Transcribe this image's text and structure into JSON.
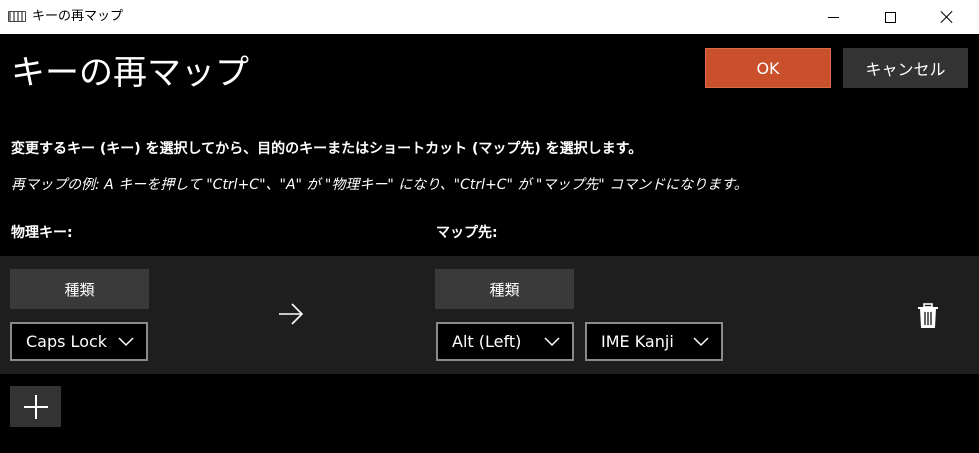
{
  "window": {
    "title": "キーの再マップ",
    "app_icon": "keyboard-icon",
    "controls": [
      "minimize-icon",
      "maximize-icon",
      "close-icon"
    ]
  },
  "header": {
    "title": "キーの再マップ",
    "ok_label": "OK",
    "cancel_label": "キャンセル"
  },
  "instruction": "変更するキー (キー) を選択してから、目的のキーまたはショートカット (マップ先) を選択します。",
  "example": "再マップの例: A キーを押して \"Ctrl+C\"、\"A\" が \"物理キー\" になり、\"Ctrl+C\" が \"マップ先\" コマンドになります。",
  "columns": {
    "physical_label": "物理キー:",
    "mapped_label": "マップ先:"
  },
  "mapping": {
    "physical": {
      "type_button_label": "種類",
      "selected_key": "Caps Lock"
    },
    "arrow_icon": "arrow-right-icon",
    "mapped": {
      "type_button_label": "種類",
      "selected_keys": [
        "Alt (Left)",
        "IME Kanji"
      ]
    },
    "delete_icon": "trash-icon"
  },
  "add_icon": "plus-icon",
  "colors": {
    "background": "#000000",
    "row_background": "#1e1e1e",
    "accent_ok": "#c9502a",
    "button_gray": "#333333",
    "type_button_gray": "#3a3a3a"
  }
}
